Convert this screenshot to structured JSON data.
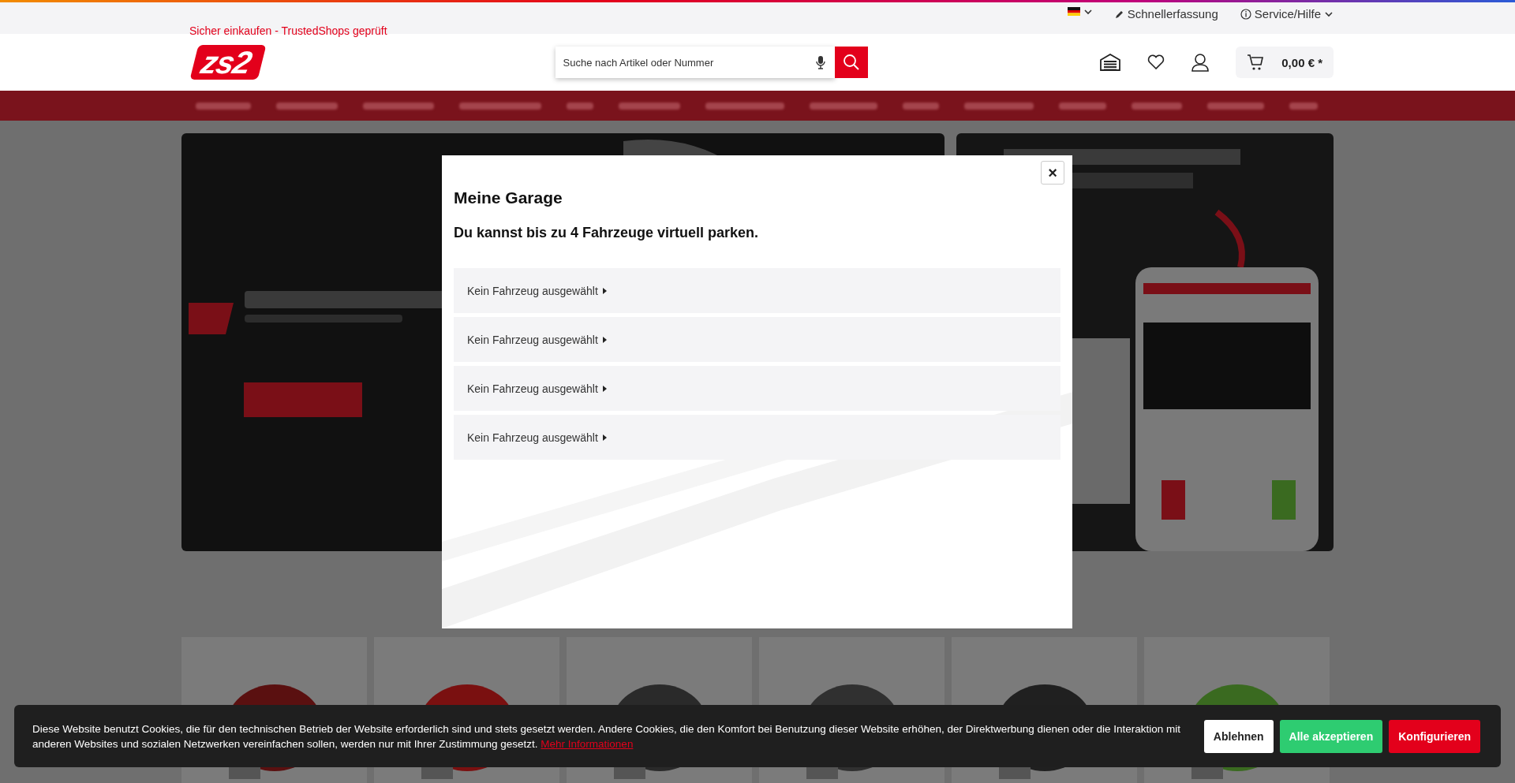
{
  "top_bar": {
    "trust_text": "Sicher einkaufen - TrustedShops geprüft",
    "quick_entry": "Schnellerfassung",
    "service": "Service/Hilfe"
  },
  "header": {
    "logo": "zs2",
    "search": {
      "placeholder": "Suche nach Artikel oder Nummer"
    },
    "cart_total": "0,00 € *"
  },
  "modal": {
    "title": "Meine Garage",
    "subtitle": "Du kannst bis zu 4 Fahrzeuge virtuell parken.",
    "close": "×",
    "slots": [
      {
        "label": "Kein Fahrzeug ausgewählt"
      },
      {
        "label": "Kein Fahrzeug ausgewählt"
      },
      {
        "label": "Kein Fahrzeug ausgewählt"
      },
      {
        "label": "Kein Fahrzeug ausgewählt"
      }
    ]
  },
  "cookie_banner": {
    "text": "Diese Website benutzt Cookies, die für den technischen Betrieb der Website erforderlich sind und stets gesetzt werden. Andere Cookies, die den Komfort bei Benutzung dieser Website erhöhen, der Direktwerbung dienen oder die Interaktion mit anderen Websites und sozialen Netzwerken vereinfachen sollen, werden nur mit Ihrer Zustimmung gesetzt.",
    "link": "Mehr Informationen",
    "buttons": [
      {
        "label": "Ablehnen",
        "kind": "decline"
      },
      {
        "label": "Alle akzeptieren",
        "kind": "accept"
      },
      {
        "label": "Konfigurieren",
        "kind": "configure"
      }
    ]
  }
}
